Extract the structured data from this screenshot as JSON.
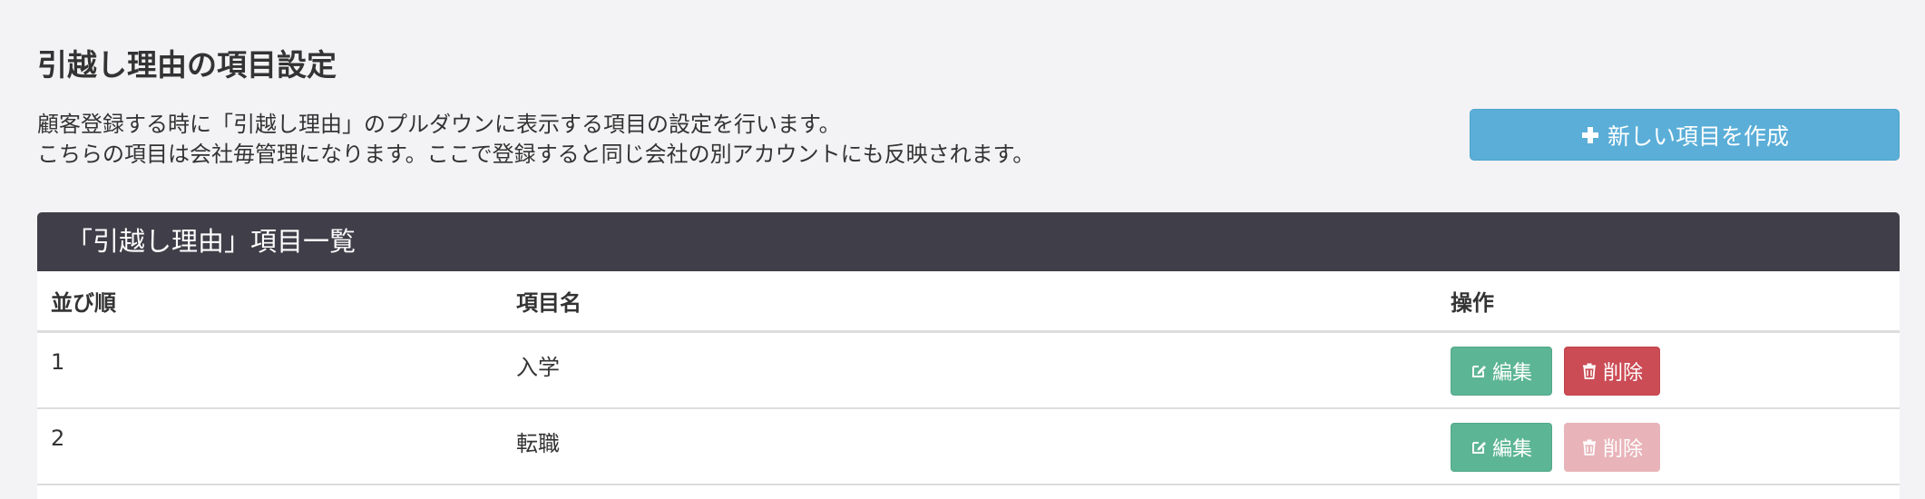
{
  "header": {
    "title": "引越し理由の項目設定",
    "description_lines": [
      "顧客登録する時に「引越し理由」のプルダウンに表示する項目の設定を行います。",
      "こちらの項目は会社毎管理になります。ここで登録すると同じ会社の別アカウントにも反映されます。"
    ],
    "create_button": {
      "label": "新しい項目を作成",
      "icon": "plus-icon"
    }
  },
  "panel": {
    "title": "「引越し理由」項目一覧",
    "columns": [
      "並び順",
      "項目名",
      "操作"
    ],
    "rows": [
      {
        "order": "1",
        "name": "入学",
        "edit_label": "編集",
        "delete_label": "削除",
        "delete_enabled": true
      },
      {
        "order": "2",
        "name": "転職",
        "edit_label": "編集",
        "delete_label": "削除",
        "delete_enabled": false
      }
    ]
  },
  "colors": {
    "background": "#f3f3f5",
    "primary_button": "#5aaed8",
    "panel_heading": "#403e48",
    "edit_button": "#5cb595",
    "delete_button": "#cb4c55",
    "delete_button_disabled": "#e8b4b9"
  }
}
